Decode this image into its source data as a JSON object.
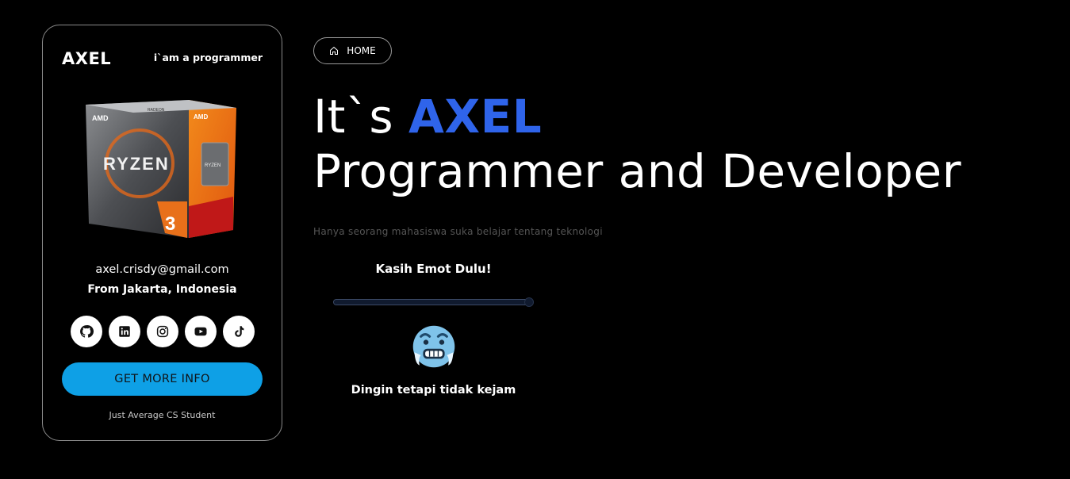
{
  "card": {
    "brand": "AXEL",
    "tagline": "i`am a programmer",
    "product_image": "amd-ryzen-3-box",
    "email": "axel.crisdy@gmail.com",
    "location": "From Jakarta, Indonesia",
    "socials": [
      {
        "name": "github",
        "icon": "github-icon"
      },
      {
        "name": "linkedin",
        "icon": "linkedin-icon"
      },
      {
        "name": "instagram",
        "icon": "instagram-icon"
      },
      {
        "name": "youtube",
        "icon": "youtube-icon"
      },
      {
        "name": "tiktok",
        "icon": "tiktok-icon"
      }
    ],
    "button_label": "GET MORE INFO",
    "footer": "Just Average CS Student"
  },
  "nav": {
    "home_label": "HOME",
    "home_icon": "home-icon"
  },
  "hero": {
    "prefix": "It`s ",
    "name": "AXEL",
    "line2": "Programmer and Developer",
    "subtitle": "Hanya seorang mahasiswa suka belajar tentang teknologi"
  },
  "emote": {
    "title": "Kasih Emot Dulu!",
    "slider_value": 1.0,
    "emoji": "cold-face-icon",
    "caption": "Dingin tetapi tidak kejam"
  },
  "colors": {
    "accent": "#2f64ea",
    "button": "#0ea0e6",
    "background": "#000000"
  }
}
